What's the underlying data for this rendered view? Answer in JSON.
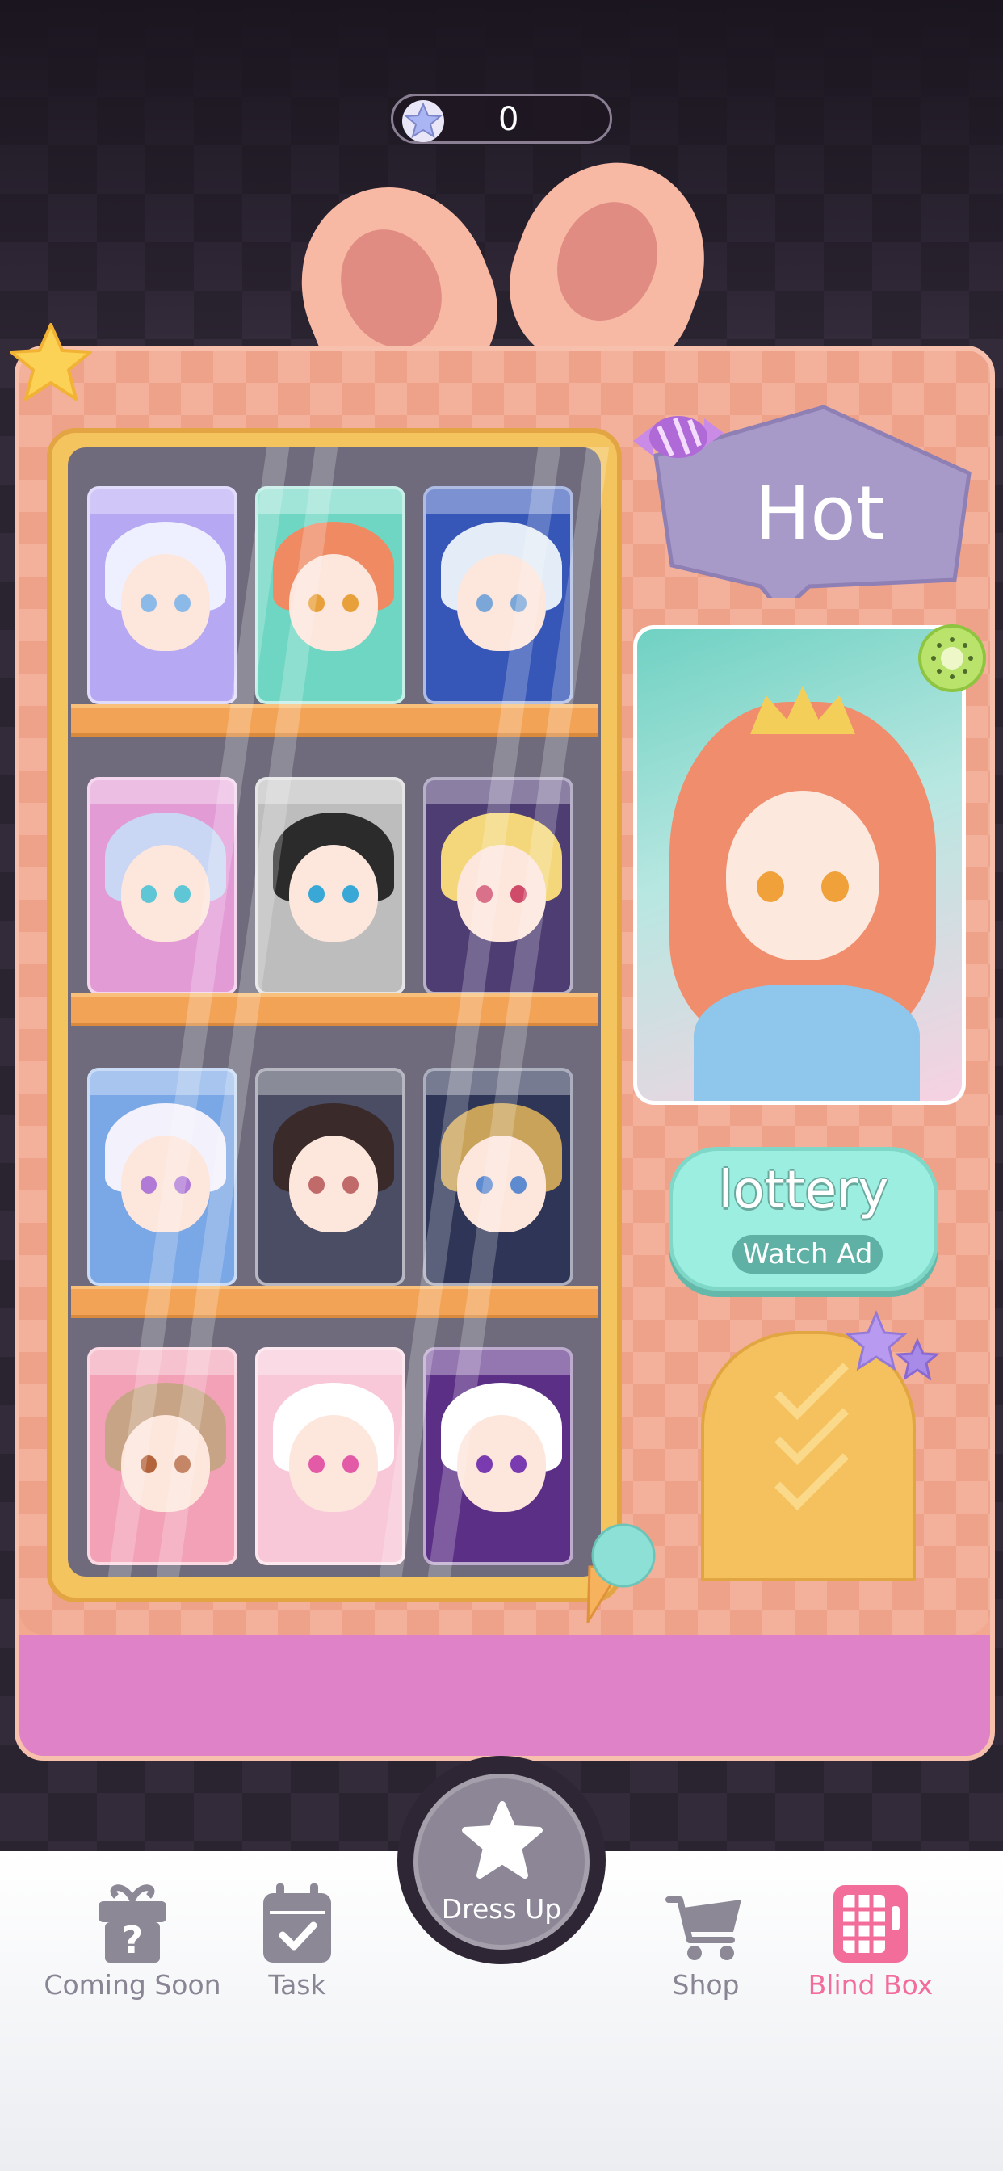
{
  "header": {
    "star_count": "0",
    "star_icon": "star-currency-icon"
  },
  "machine": {
    "hot_label": "Hot",
    "lottery_label": "lottery",
    "watch_ad_label": "Watch Ad",
    "shelves": [
      [
        {
          "name": "blind-box-card-white-hair",
          "hair": "#eef0ff",
          "bg": "#b7a8f4",
          "eye": "#8bb9e8"
        },
        {
          "name": "blind-box-card-orange-hair",
          "hair": "#f08a63",
          "bg": "#6fd6c3",
          "eye": "#e8a03a"
        },
        {
          "name": "blind-box-card-silver-hair",
          "hair": "#e4ecf7",
          "bg": "#3656b8",
          "eye": "#7aa6d8"
        }
      ],
      [
        {
          "name": "blind-box-card-pastel-hair",
          "hair": "#c9d6f4",
          "bg": "#e39bd6",
          "eye": "#5ec6d4"
        },
        {
          "name": "blind-box-card-black-white-hair",
          "hair": "#2b2b2b",
          "bg": "#bdbdbd",
          "eye": "#3aa8d6"
        },
        {
          "name": "blind-box-card-blonde-hat",
          "hair": "#f4d77a",
          "bg": "#4d3d73",
          "eye": "#d04a6a"
        }
      ],
      [
        {
          "name": "blind-box-card-fox-ears",
          "hair": "#f3f1fb",
          "bg": "#7aa7e6",
          "eye": "#b07ad6"
        },
        {
          "name": "blind-box-card-dark-hair",
          "hair": "#3a2a2a",
          "bg": "#4a4d63",
          "eye": "#c06a6a"
        },
        {
          "name": "blind-box-card-gold-veil",
          "hair": "#c9a35a",
          "bg": "#2e3557",
          "eye": "#5e8ad0"
        }
      ],
      [
        {
          "name": "blind-box-card-cat-ears",
          "hair": "#c8a486",
          "bg": "#f2a1b6",
          "eye": "#b4643c"
        },
        {
          "name": "blind-box-card-bunny-cup",
          "hair": "#ffffff",
          "bg": "#f8c8d8",
          "eye": "#e35aa6"
        },
        {
          "name": "blind-box-card-purple-cup",
          "hair": "#ffffff",
          "bg": "#5b2f86",
          "eye": "#7a3ab0"
        }
      ]
    ]
  },
  "nav": {
    "items": [
      {
        "name": "nav-coming-soon",
        "label": "Coming Soon",
        "icon": "gift-question-icon"
      },
      {
        "name": "nav-task",
        "label": "Task",
        "icon": "calendar-check-icon"
      },
      {
        "name": "nav-shop",
        "label": "Shop",
        "icon": "cart-icon"
      },
      {
        "name": "nav-blind-box",
        "label": "Blind Box",
        "icon": "vending-machine-icon"
      }
    ],
    "center_label": "Dress Up",
    "center_icon": "star-icon",
    "active": "Blind Box"
  },
  "colors": {
    "accent": "#f26d9a",
    "machine": "#f2a98f",
    "lottery": "#9cefe0",
    "inactive": "#8a8594"
  }
}
